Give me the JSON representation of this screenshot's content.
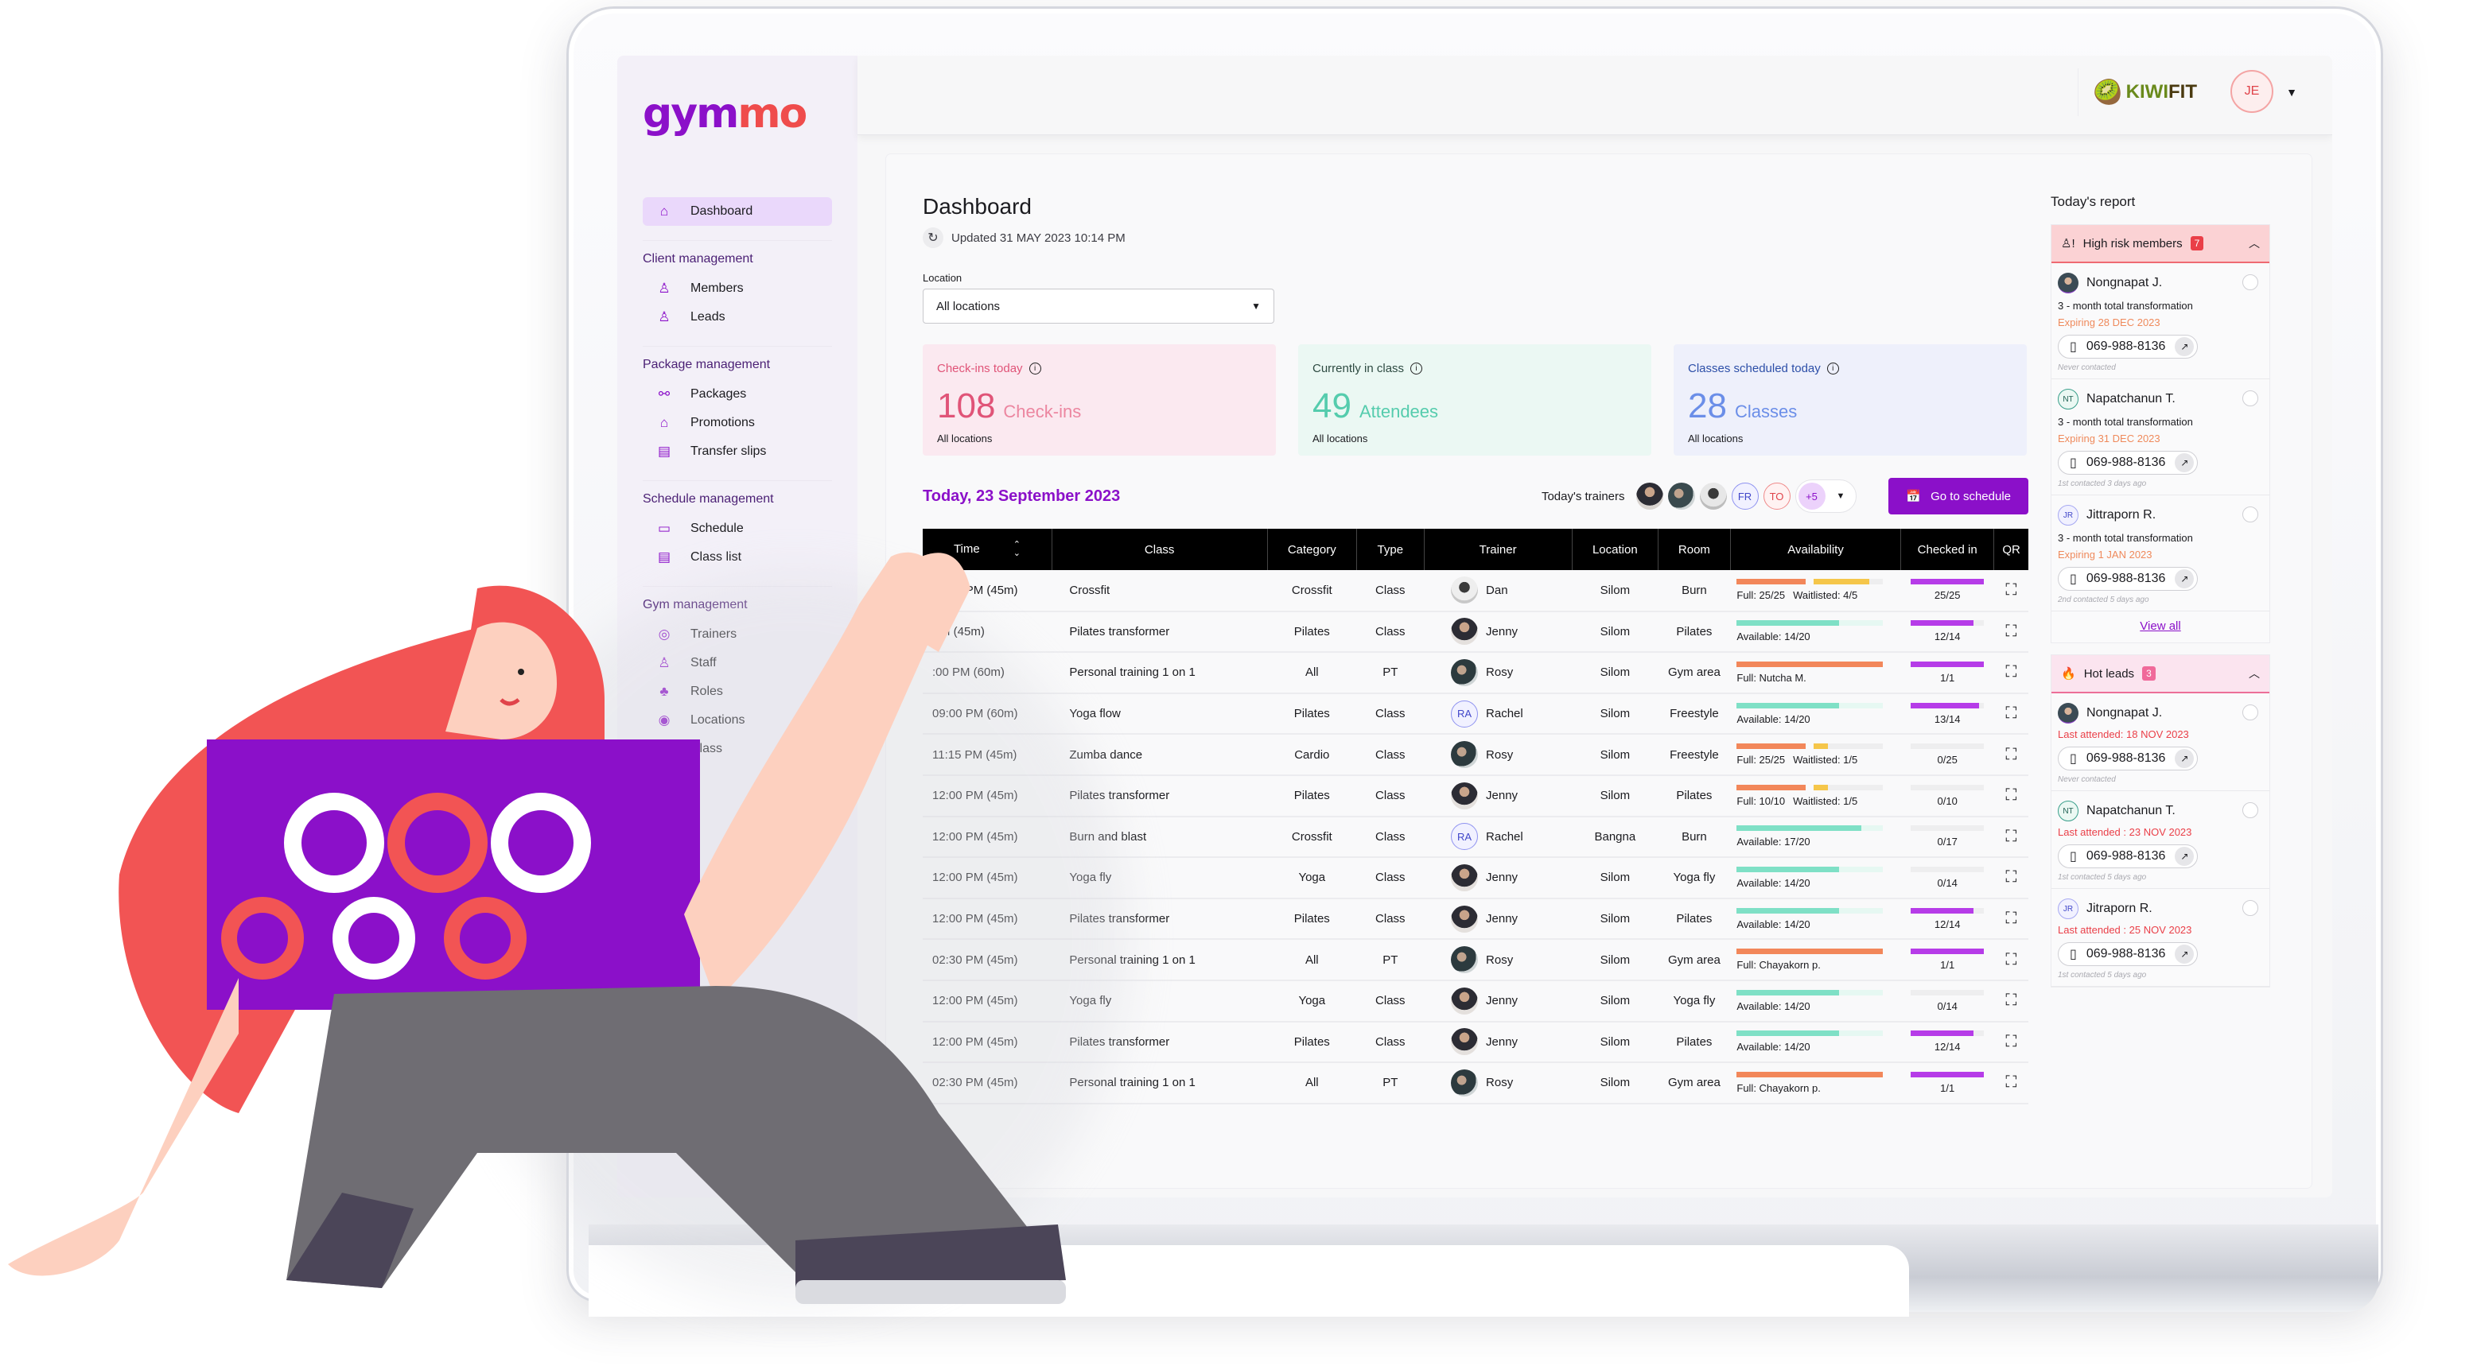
{
  "app": {
    "logo": {
      "part1": "gym",
      "part2": "mo"
    },
    "brand": {
      "part1": "KIWI",
      "part2": "FIT"
    },
    "user_initials": "JE"
  },
  "sidebar": {
    "top_item": {
      "label": "Dashboard",
      "icon": "home-icon",
      "active": true
    },
    "groups": [
      {
        "title": "Client management",
        "items": [
          {
            "label": "Members",
            "icon": "user-icon",
            "glyph": "♙"
          },
          {
            "label": "Leads",
            "icon": "user-check-icon",
            "glyph": "♙"
          }
        ]
      },
      {
        "title": "Package management",
        "items": [
          {
            "label": "Packages",
            "icon": "dumbbell-icon",
            "glyph": "⚯"
          },
          {
            "label": "Promotions",
            "icon": "tag-percent-icon",
            "glyph": "⌂"
          },
          {
            "label": "Transfer slips",
            "icon": "receipt-icon",
            "glyph": "▤"
          }
        ]
      },
      {
        "title": "Schedule management",
        "items": [
          {
            "label": "Schedule",
            "icon": "calendar-icon",
            "glyph": "▭"
          },
          {
            "label": "Class list",
            "icon": "clipboard-icon",
            "glyph": "▤"
          }
        ]
      },
      {
        "title": "Gym management",
        "items": [
          {
            "label": "Trainers",
            "icon": "whistle-icon",
            "glyph": "◎"
          },
          {
            "label": "Staff",
            "icon": "users-icon",
            "glyph": "♙"
          },
          {
            "label": "Roles",
            "icon": "hierarchy-icon",
            "glyph": "♣"
          },
          {
            "label": "Locations",
            "icon": "map-pin-icon",
            "glyph": "◉"
          },
          {
            "label": "Class",
            "icon": "table-icon",
            "glyph": "▦"
          }
        ]
      }
    ]
  },
  "header": {
    "title": "Dashboard",
    "updated": "Updated 31 MAY 2023 10:14 PM",
    "location_label": "Location",
    "location_value": "All locations"
  },
  "stats": [
    {
      "label": "Check-ins today",
      "value": "108",
      "unit": "Check-ins",
      "sub": "All locations"
    },
    {
      "label": "Currently in class",
      "value": "49",
      "unit": "Attendees",
      "sub": "All locations"
    },
    {
      "label": "Classes scheduled today",
      "value": "28",
      "unit": "Classes",
      "sub": "All locations"
    }
  ],
  "today": {
    "title": "Today, 23 September 2023",
    "trainers_label": "Today's trainers",
    "trainer_initials": [
      "FR",
      "TO"
    ],
    "more_count": "+5",
    "go_schedule": "Go to schedule"
  },
  "table": {
    "columns": [
      "Time",
      "Class",
      "Category",
      "Type",
      "Trainer",
      "Location",
      "Room",
      "Availability",
      "Checked in",
      "QR"
    ],
    "colors": {
      "full": "#f2875a",
      "waitlist": "#f5c64a",
      "available": "#7fe0c6",
      "checked": "#b63ce8"
    },
    "rows": [
      {
        "time": "09:00 PM (45m)",
        "class": "Crossfit",
        "category": "Crossfit",
        "type": "Class",
        "trainer": "Dan",
        "avatar": "dan",
        "location": "Silom",
        "room": "Burn",
        "avail_kind": "full_wait",
        "primary_text": "Full: 25/25",
        "primary_frac": 1.0,
        "wait_text": "Waitlisted: 4/5",
        "wait_frac": 0.8,
        "checked_text": "25/25",
        "checked_frac": 1.0
      },
      {
        "time": "PM (45m)",
        "class": "Pilates transformer",
        "category": "Pilates",
        "type": "Class",
        "trainer": "Jenny",
        "avatar": "jenny",
        "location": "Silom",
        "room": "Pilates",
        "avail_kind": "available",
        "primary_text": "Available: 14/20",
        "primary_frac": 0.7,
        "checked_text": "12/14",
        "checked_frac": 0.857
      },
      {
        "time": ":00 PM (60m)",
        "class": "Personal training 1 on 1",
        "category": "All",
        "type": "PT",
        "trainer": "Rosy",
        "avatar": "rosy",
        "location": "Silom",
        "room": "Gym area",
        "avail_kind": "full",
        "primary_text": "Full: Nutcha M.",
        "primary_frac": 1.0,
        "checked_text": "1/1",
        "checked_frac": 1.0
      },
      {
        "time": "09:00 PM (60m)",
        "class": "Yoga flow",
        "category": "Pilates",
        "type": "Class",
        "trainer": "Rachel",
        "avatar": "RA",
        "location": "Silom",
        "room": "Freestyle",
        "avail_kind": "available",
        "primary_text": "Available: 14/20",
        "primary_frac": 0.7,
        "checked_text": "13/14",
        "checked_frac": 0.929
      },
      {
        "time": "11:15 PM (45m)",
        "class": "Zumba dance",
        "category": "Cardio",
        "type": "Class",
        "trainer": "Rosy",
        "avatar": "rosy",
        "location": "Silom",
        "room": "Freestyle",
        "avail_kind": "full_wait",
        "primary_text": "Full: 25/25",
        "primary_frac": 1.0,
        "wait_text": "Waitlisted: 1/5",
        "wait_frac": 0.2,
        "checked_text": "0/25",
        "checked_frac": 0
      },
      {
        "time": "12:00 PM (45m)",
        "class": "Pilates transformer",
        "category": "Pilates",
        "type": "Class",
        "trainer": "Jenny",
        "avatar": "jenny",
        "location": "Silom",
        "room": "Pilates",
        "avail_kind": "full_wait",
        "primary_text": "Full: 10/10",
        "primary_frac": 1.0,
        "wait_text": "Waitlisted: 1/5",
        "wait_frac": 0.2,
        "checked_text": "0/10",
        "checked_frac": 0
      },
      {
        "time": "12:00 PM (45m)",
        "class": "Burn and blast",
        "category": "Crossfit",
        "type": "Class",
        "trainer": "Rachel",
        "avatar": "RA",
        "location": "Bangna",
        "room": "Burn",
        "avail_kind": "available",
        "primary_text": "Available: 17/20",
        "primary_frac": 0.85,
        "checked_text": "0/17",
        "checked_frac": 0
      },
      {
        "time": "12:00 PM (45m)",
        "class": "Yoga fly",
        "category": "Yoga",
        "type": "Class",
        "trainer": "Jenny",
        "avatar": "jenny",
        "location": "Silom",
        "room": "Yoga fly",
        "avail_kind": "available",
        "primary_text": "Available: 14/20",
        "primary_frac": 0.7,
        "checked_text": "0/14",
        "checked_frac": 0
      },
      {
        "time": "12:00 PM (45m)",
        "class": "Pilates transformer",
        "category": "Pilates",
        "type": "Class",
        "trainer": "Jenny",
        "avatar": "jenny",
        "location": "Silom",
        "room": "Pilates",
        "avail_kind": "available",
        "primary_text": "Available: 14/20",
        "primary_frac": 0.7,
        "checked_text": "12/14",
        "checked_frac": 0.857
      },
      {
        "time": "02:30 PM (45m)",
        "class": "Personal training 1 on 1",
        "category": "All",
        "type": "PT",
        "trainer": "Rosy",
        "avatar": "rosy",
        "location": "Silom",
        "room": "Gym area",
        "avail_kind": "full",
        "primary_text": "Full: Chayakorn p.",
        "primary_frac": 1.0,
        "checked_text": "1/1",
        "checked_frac": 1.0
      },
      {
        "time": "12:00 PM (45m)",
        "class": "Yoga fly",
        "category": "Yoga",
        "type": "Class",
        "trainer": "Jenny",
        "avatar": "jenny",
        "location": "Silom",
        "room": "Yoga fly",
        "avail_kind": "available",
        "primary_text": "Available: 14/20",
        "primary_frac": 0.7,
        "checked_text": "0/14",
        "checked_frac": 0
      },
      {
        "time": "12:00 PM (45m)",
        "class": "Pilates transformer",
        "category": "Pilates",
        "type": "Class",
        "trainer": "Jenny",
        "avatar": "jenny",
        "location": "Silom",
        "room": "Pilates",
        "avail_kind": "available",
        "primary_text": "Available: 14/20",
        "primary_frac": 0.7,
        "checked_text": "12/14",
        "checked_frac": 0.857
      },
      {
        "time": "02:30 PM (45m)",
        "class": "Personal training 1 on 1",
        "category": "All",
        "type": "PT",
        "trainer": "Rosy",
        "avatar": "rosy",
        "location": "Silom",
        "room": "Gym area",
        "avail_kind": "full",
        "primary_text": "Full: Chayakorn p.",
        "primary_frac": 1.0,
        "checked_text": "1/1",
        "checked_frac": 1.0
      }
    ]
  },
  "report": {
    "title": "Today's report",
    "high_risk": {
      "label": "High risk members",
      "count": "7",
      "members": [
        {
          "name": "Nongnapat J.",
          "avatar": "photo",
          "package": "3 - month total transformation",
          "status": "Expiring 28 DEC 2023",
          "phone": "069-988-8136",
          "contact": "Never contacted"
        },
        {
          "name": "Napatchanun T.",
          "avatar": "NT",
          "package": "3 - month total transformation",
          "status": "Expiring 31 DEC 2023",
          "phone": "069-988-8136",
          "contact": "1st contacted 3 days ago"
        },
        {
          "name": "Jittraporn R.",
          "avatar": "JR",
          "package": "3 - month total transformation",
          "status": "Expiring 1 JAN 2023",
          "phone": "069-988-8136",
          "contact": "2nd contacted 5 days ago"
        }
      ],
      "view_all": "View all"
    },
    "hot_leads": {
      "label": "Hot leads",
      "count": "3",
      "members": [
        {
          "name": "Nongnapat J.",
          "avatar": "photo",
          "status": "Last attended: 18 NOV 2023",
          "phone": "069-988-8136",
          "contact": "Never contacted"
        },
        {
          "name": "Napatchanun T.",
          "avatar": "NT",
          "status": "Last attended : 23 NOV 2023",
          "phone": "069-988-8136",
          "contact": "1st contacted 5 days ago"
        },
        {
          "name": "Jitraporn R.",
          "avatar": "JR",
          "status": "Last attended : 25 NOV 2023",
          "phone": "069-988-8136",
          "contact": "1st contacted 5 days ago"
        }
      ]
    }
  }
}
